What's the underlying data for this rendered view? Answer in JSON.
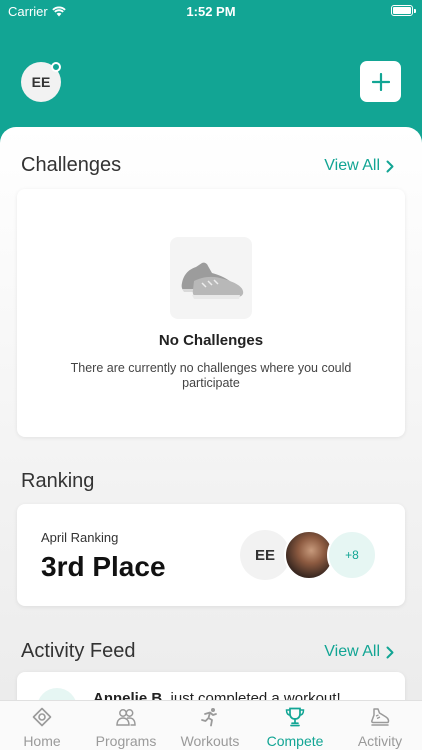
{
  "status_bar": {
    "carrier": "Carrier",
    "time": "1:52 PM"
  },
  "header": {
    "avatar_initials": "EE"
  },
  "challenges": {
    "title": "Challenges",
    "view_all": "View All",
    "empty_title": "No Challenges",
    "empty_description": "There are currently no challenges where you could participate"
  },
  "ranking": {
    "title": "Ranking",
    "period": "April Ranking",
    "place": "3rd Place",
    "avatar_initials": "EE",
    "more_count": "+8"
  },
  "activity_feed": {
    "title": "Activity Feed",
    "view_all": "View All",
    "item_name": "Annelie B.",
    "item_text": "just completed a workout!"
  },
  "tabs": [
    {
      "label": "Home",
      "icon": "home-icon",
      "active": false
    },
    {
      "label": "Programs",
      "icon": "people-icon",
      "active": false
    },
    {
      "label": "Workouts",
      "icon": "runner-icon",
      "active": false
    },
    {
      "label": "Compete",
      "icon": "trophy-icon",
      "active": true
    },
    {
      "label": "Activity",
      "icon": "shoe-icon",
      "active": false
    }
  ],
  "colors": {
    "accent": "#12a594",
    "background": "#f3f3f3",
    "inactive": "#9a9a9a"
  }
}
